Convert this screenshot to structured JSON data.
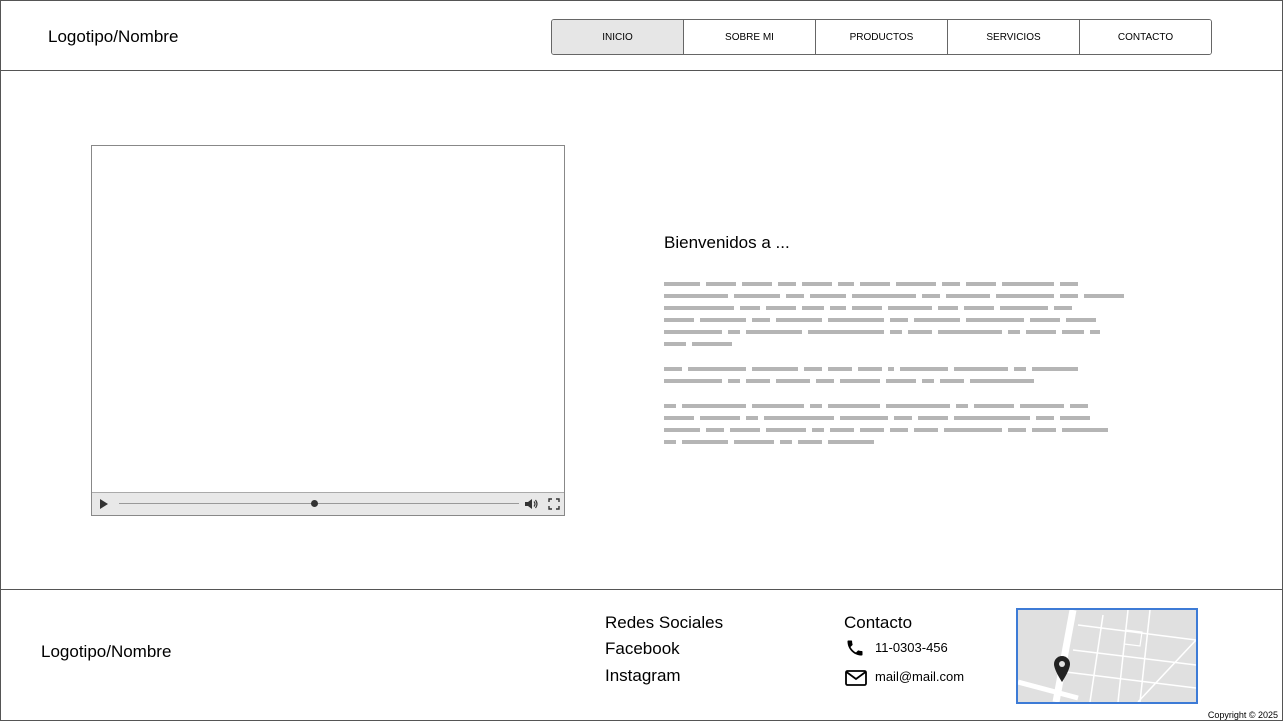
{
  "header": {
    "logo": "Logotipo/Nombre",
    "nav": [
      {
        "label": "INICIO",
        "active": true
      },
      {
        "label": "SOBRE MI",
        "active": false
      },
      {
        "label": "PRODUCTOS",
        "active": false
      },
      {
        "label": "SERVICIOS",
        "active": false
      },
      {
        "label": "CONTACTO",
        "active": false
      }
    ]
  },
  "main": {
    "video": {
      "controls": [
        "play-icon",
        "seek-slider",
        "volume-icon",
        "fullscreen-icon"
      ]
    },
    "welcome_title": "Bienvenidos a ..."
  },
  "footer": {
    "logo": "Logotipo/Nombre",
    "social": {
      "title": "Redes Sociales",
      "links": [
        "Facebook",
        "Instagram"
      ]
    },
    "contact": {
      "title": "Contacto",
      "phone": "11-0303-456",
      "email": "mail@mail.com",
      "icons": [
        "phone-icon",
        "mail-icon"
      ]
    },
    "map_icon": "map-pin-icon",
    "copyright": "Copyright © 2025"
  },
  "colors": {
    "active_nav_bg": "#e6e6e6",
    "border": "#555555",
    "map_border": "#3d7bd6",
    "placeholder_text": "#b5b5b5"
  }
}
